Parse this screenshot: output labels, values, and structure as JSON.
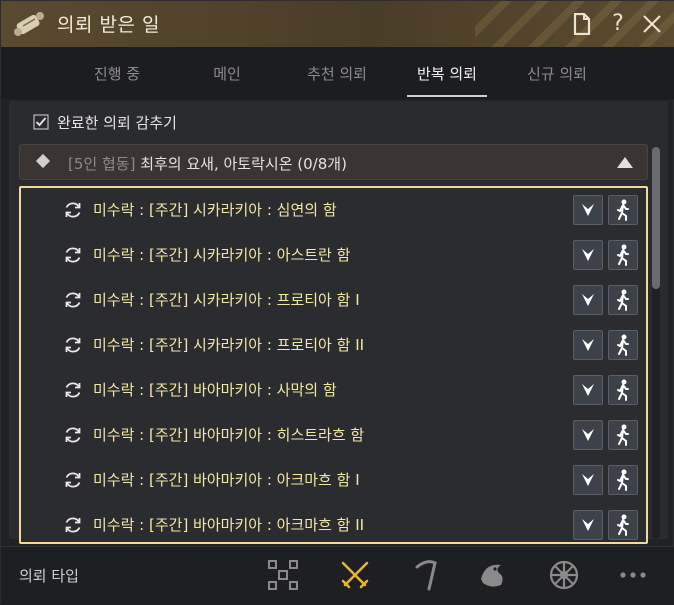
{
  "window": {
    "title": "의뢰 받은 일",
    "icons": [
      "scroll-icon",
      "document-icon",
      "help-icon",
      "close-icon"
    ]
  },
  "tabs": [
    {
      "label": "진행 중",
      "active": false
    },
    {
      "label": "메인",
      "active": false
    },
    {
      "label": "추천 의뢰",
      "active": false
    },
    {
      "label": "반복 의뢰",
      "active": true
    },
    {
      "label": "신규 의뢰",
      "active": false
    }
  ],
  "filter": {
    "hide_completed_label": "완료한 의뢰 감추기",
    "checked": true
  },
  "group": {
    "tag": "[5인 협동]",
    "name": "최후의 요새, 아토락시온 (0/8개)",
    "expanded": true
  },
  "quests": [
    {
      "title": "미수락 : [주간] 시카라키아 : 심연의 함"
    },
    {
      "title": "미수락 : [주간] 시카라키아 : 아스트란 함"
    },
    {
      "title": "미수락 : [주간] 시카라키아 : 프로티아 함 I"
    },
    {
      "title": "미수락 : [주간] 시카라키아 : 프로티아 함 II"
    },
    {
      "title": "미수락 : [주간] 바아마키아 : 사막의 함"
    },
    {
      "title": "미수락 : [주간] 바아마키아 : 히스트라흐 함"
    },
    {
      "title": "미수락 : [주간] 바아마키아 : 아크마흐 함 I"
    },
    {
      "title": "미수락 : [주간] 바아마키아 : 아크마흐 함 II"
    }
  ],
  "bottom": {
    "type_label": "의뢰 타입",
    "type_icons": [
      "grid-icon",
      "combat-swords-icon",
      "pickaxe-icon",
      "fish-icon",
      "wheel-icon",
      "more-icon"
    ],
    "active_icon": "combat-swords-icon"
  },
  "colors": {
    "quest_text": "#f3e7a6",
    "highlight_border": "#f4d99a",
    "active_type_icon": "#e8b23a"
  }
}
